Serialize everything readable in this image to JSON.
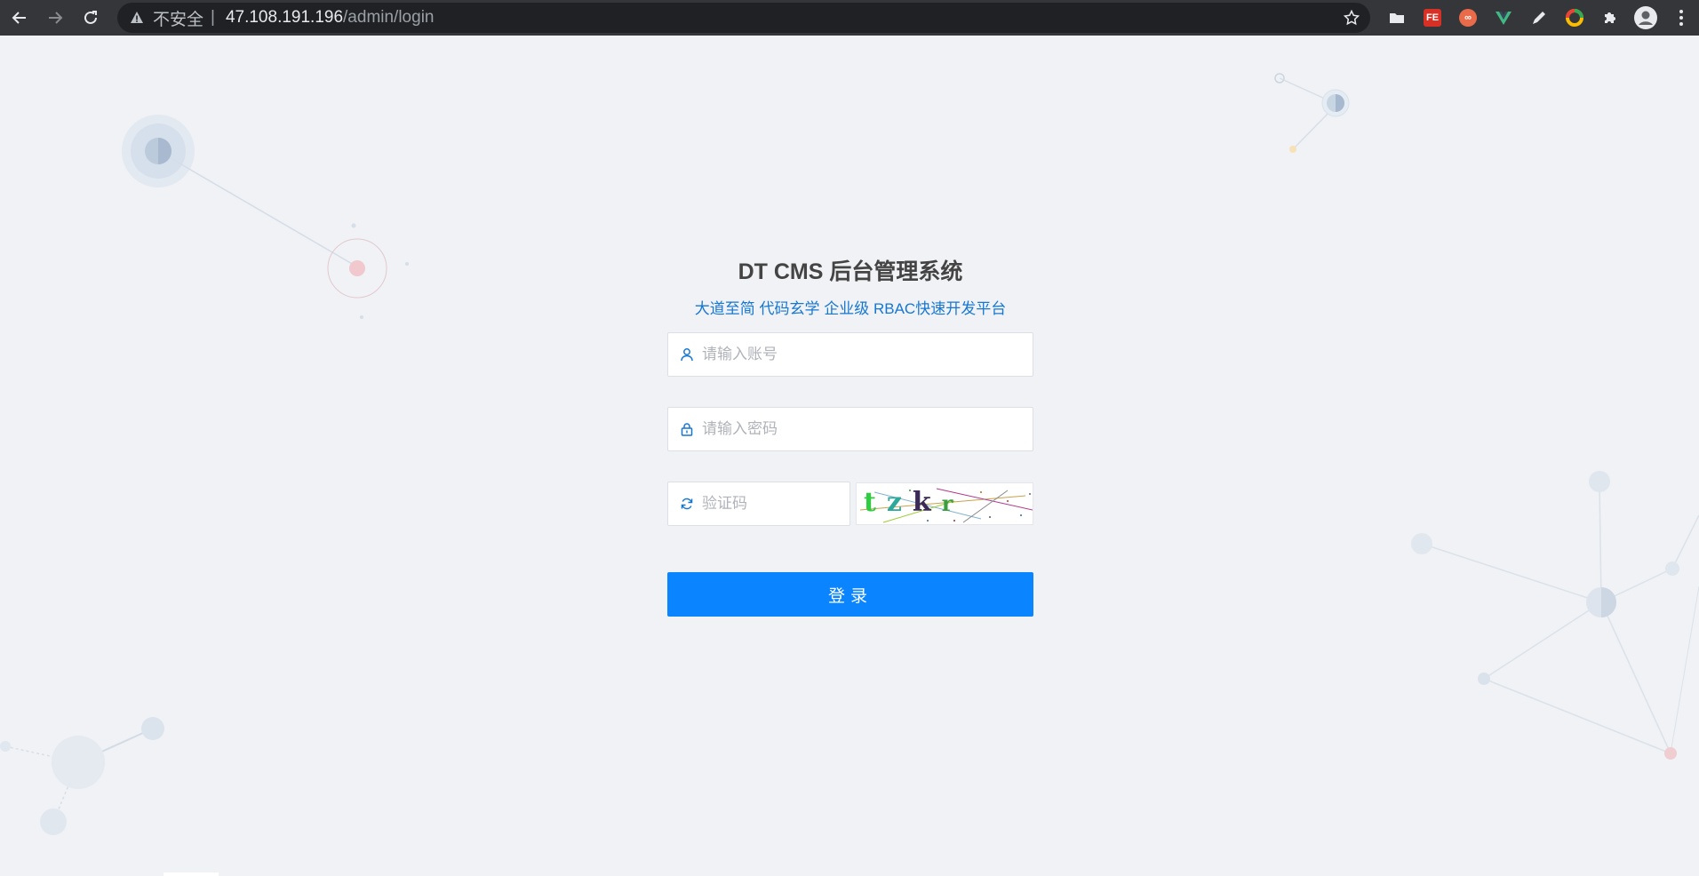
{
  "browser": {
    "insecure_label": "不安全",
    "separator": "|",
    "url_host": "47.108.191.196",
    "url_path": "/admin/login",
    "extensions": [
      {
        "name": "folder-extension",
        "glyph": "",
        "color": "#e8eaed"
      },
      {
        "name": "fe-extension",
        "glyph": "FE",
        "color": "#d93025"
      },
      {
        "name": "infinity-extension",
        "glyph": "∞",
        "color": "#ea6b4a"
      },
      {
        "name": "vue-extension",
        "glyph": "V",
        "color": "#42b883"
      },
      {
        "name": "pen-extension",
        "glyph": "",
        "color": "#e8eaed"
      },
      {
        "name": "color-wheel-extension",
        "glyph": "",
        "color": "#fbbc04"
      }
    ]
  },
  "login": {
    "title": "DT CMS 后台管理系统",
    "subtitle": "大道至简 代码玄学 企业级 RBAC快速开发平台",
    "username_placeholder": "请输入账号",
    "password_placeholder": "请输入密码",
    "captcha_placeholder": "验证码",
    "captcha_text": "tzkr",
    "submit_label": "登录"
  },
  "colors": {
    "accent": "#0a84ff",
    "subtitle": "#1677d2",
    "page_bg": "#f0f2f5"
  }
}
